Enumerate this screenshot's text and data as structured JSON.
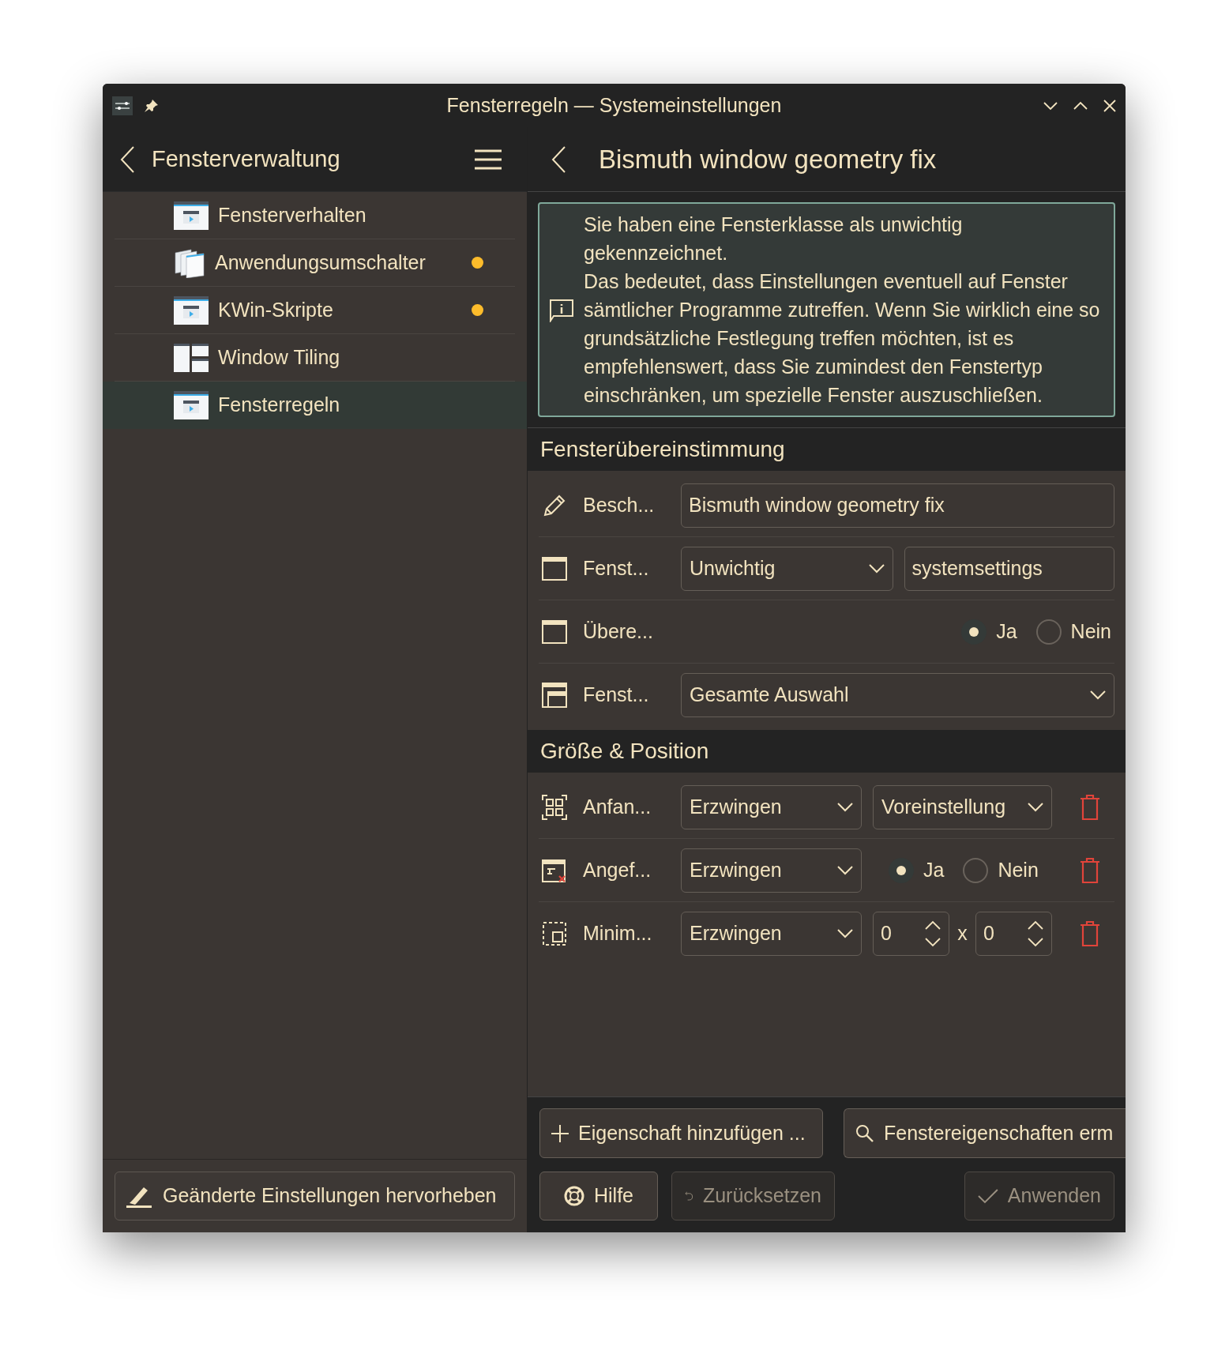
{
  "window": {
    "title": "Fensterregeln — Systemeinstellungen"
  },
  "sidebar": {
    "title": "Fensterverwaltung",
    "items": [
      {
        "label": "Fensterverhalten",
        "changed": false,
        "selected": false
      },
      {
        "label": "Anwendungsumschalter",
        "changed": true,
        "selected": false
      },
      {
        "label": "KWin-Skripte",
        "changed": true,
        "selected": false
      },
      {
        "label": "Window Tiling",
        "changed": false,
        "selected": false
      },
      {
        "label": "Fensterregeln",
        "changed": false,
        "selected": true
      }
    ],
    "footer_button": "Geänderte Einstellungen hervorheben"
  },
  "page": {
    "title": "Bismuth window geometry fix",
    "message": "Sie haben eine Fensterklasse als unwichtig gekennzeichnet.\nDas bedeutet, dass Einstellungen eventuell auf Fenster sämtlicher Programme zutreffen. Wenn Sie wirklich eine so grundsätzliche Festlegung treffen möchten, ist es empfehlenswert, dass Sie zumindest den Fenstertyp einschränken, um spezielle Fenster auszuschließen."
  },
  "sections": [
    {
      "title": "Fensterübereinstimmung",
      "rows": [
        {
          "kind": "text",
          "label": "Besch...",
          "value": "Bismuth window geometry fix"
        },
        {
          "kind": "text",
          "label": "Fenst...",
          "policy": "Unwichtig",
          "value": "systemsettings"
        },
        {
          "kind": "radio",
          "label": "Übere...",
          "options": [
            {
              "label": "Ja",
              "selected": true
            },
            {
              "label": "Nein",
              "selected": false
            }
          ]
        },
        {
          "kind": "select",
          "label": "Fenst...",
          "choice": "Gesamte Auswahl"
        }
      ]
    },
    {
      "title": "Größe & Position",
      "rows": [
        {
          "kind": "select",
          "label": "Anfan...",
          "policy": "Erzwingen",
          "choice": "Voreinstellung",
          "removable": true
        },
        {
          "kind": "radio",
          "label": "Angef...",
          "policy": "Erzwingen",
          "options": [
            {
              "label": "Ja",
              "selected": true
            },
            {
              "label": "Nein",
              "selected": false
            }
          ],
          "removable": true
        },
        {
          "kind": "size",
          "label": "Minim...",
          "policy": "Erzwingen",
          "values": [
            "0",
            "0"
          ],
          "separator": "x",
          "removable": true
        }
      ]
    }
  ],
  "actions": [
    {
      "label": "Eigenschaft hinzufügen ..."
    },
    {
      "label": "Fenstereigenschaften erm"
    }
  ],
  "dialog_buttons": [
    {
      "label": "Hilfe",
      "disabled": false
    },
    {
      "label": "Zurücksetzen",
      "disabled": true
    },
    {
      "label": "Anwenden",
      "disabled": true
    }
  ]
}
